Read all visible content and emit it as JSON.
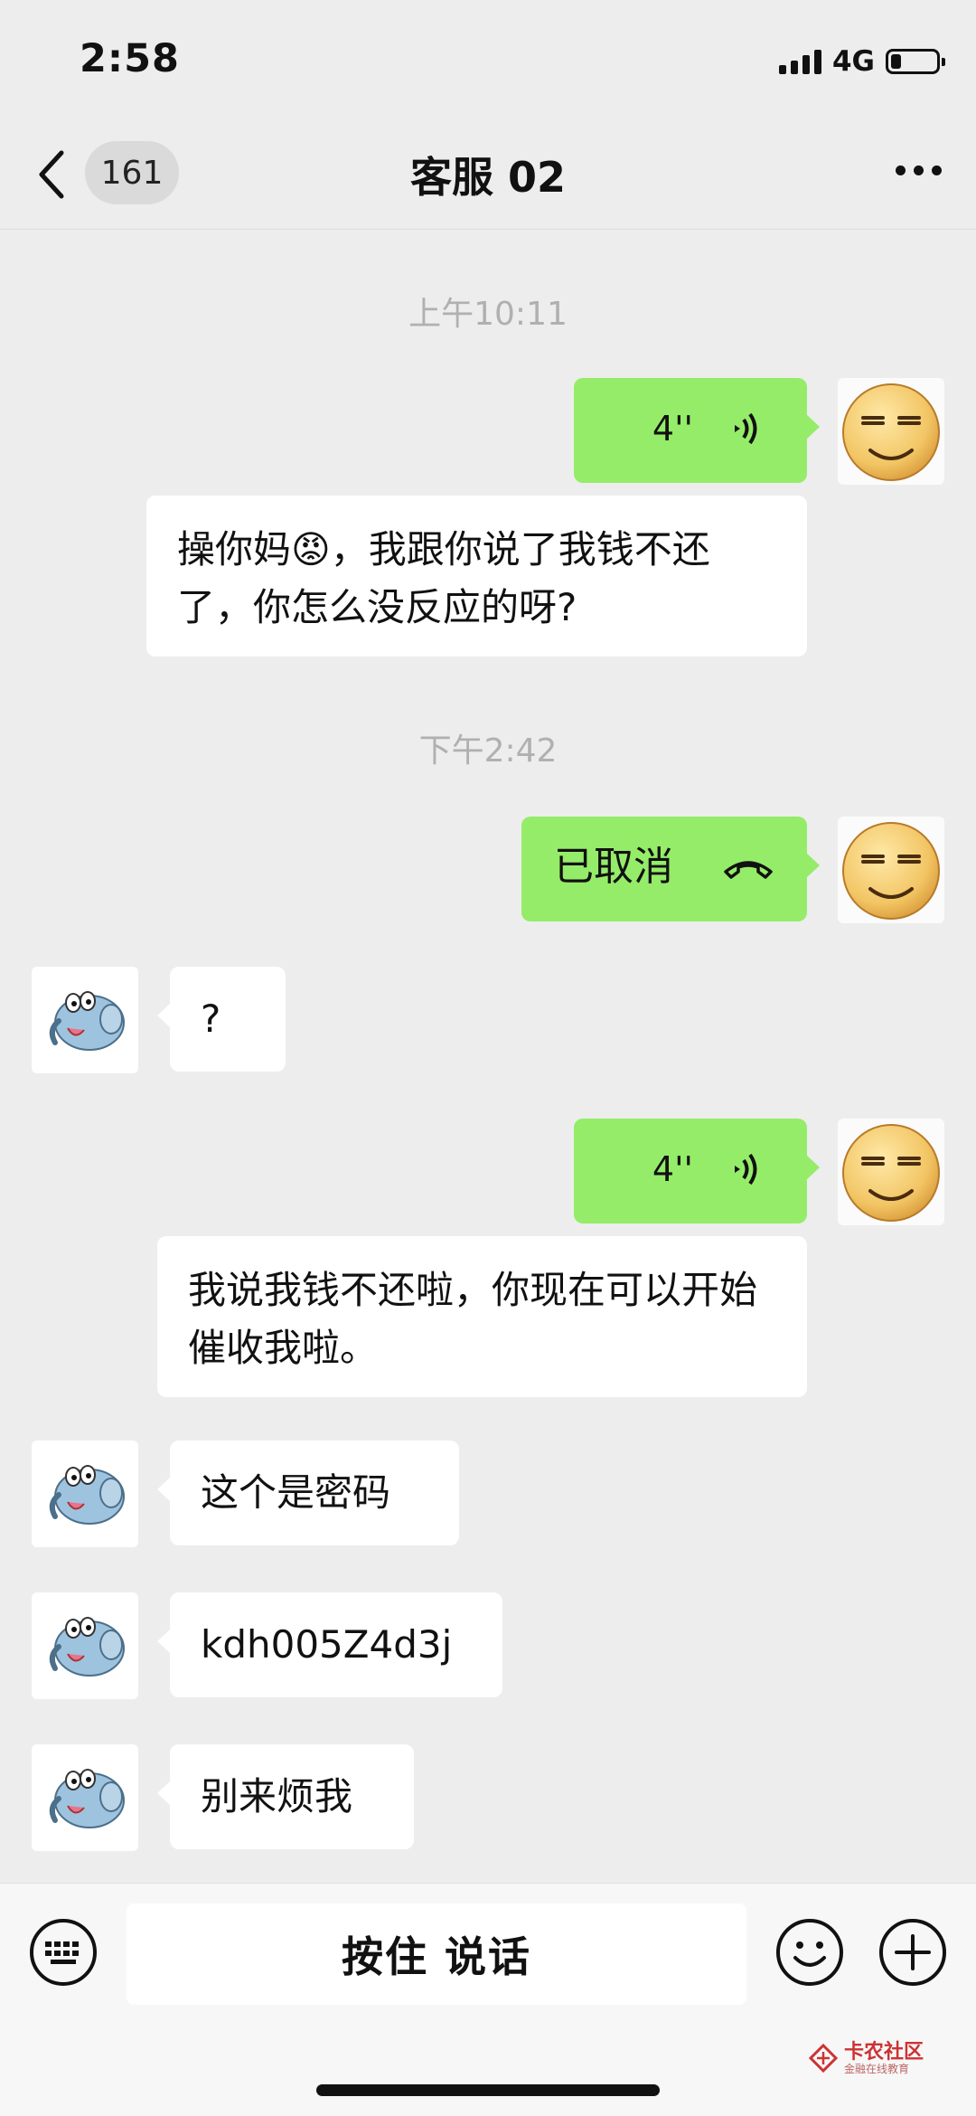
{
  "status": {
    "time": "2:58",
    "network": "4G"
  },
  "nav": {
    "back_badge": "161",
    "title": "客服 02"
  },
  "messages": {
    "time1": "上午10:11",
    "voice1_duration": "4''",
    "voice1_transcript": "操你妈😡，我跟你说了我钱不还了，你怎么没反应的呀?",
    "time2": "下午2:42",
    "call_status": "已取消",
    "reply1": "?",
    "voice2_duration": "4''",
    "voice2_transcript": "我说我钱不还啦，你现在可以开始催收我啦。",
    "reply2": "这个是密码",
    "reply3": "kdh005Z4d3j",
    "reply4": "别来烦我"
  },
  "input": {
    "hold_to_talk": "按住 说话"
  },
  "watermark": {
    "text": "卡农社区",
    "subtext": "金融在线教育"
  },
  "colors": {
    "sent_bubble": "#95ec69",
    "received_bubble": "#ffffff",
    "background": "#ededed"
  },
  "icons": [
    "chevron-left-icon",
    "more-icon",
    "voice-wave-icon",
    "hangup-icon",
    "keyboard-icon",
    "emoji-icon",
    "plus-icon"
  ]
}
